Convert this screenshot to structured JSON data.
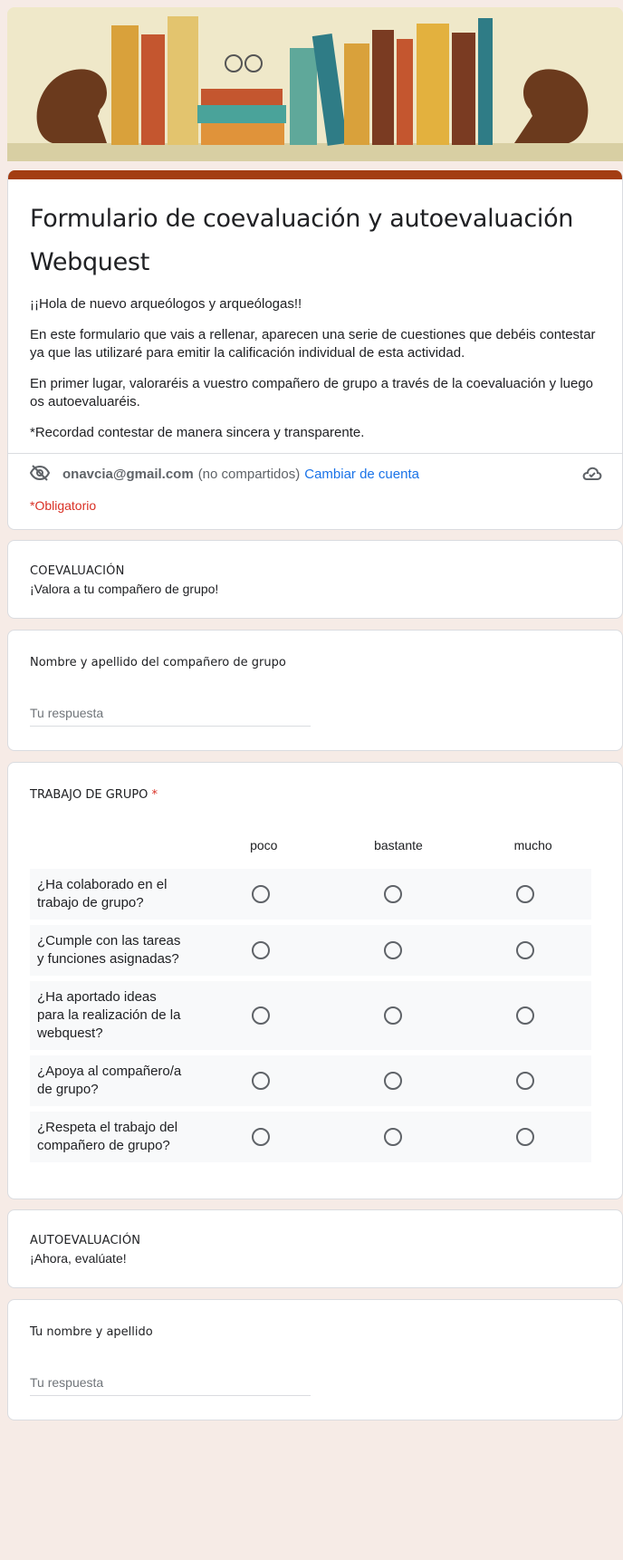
{
  "form": {
    "title": "Formulario de coevaluación y autoevaluación Webquest",
    "description": [
      "¡¡Hola de nuevo arqueólogos y arqueólogas!!",
      "En este formulario que vais a rellenar, aparecen una serie de cuestiones que debéis contestar ya que las utilizaré para emitir la calificación individual de esta actividad.",
      "En primer lugar, valoraréis a vuestro compañero de grupo a través de la coevaluación y luego os autoevaluaréis.",
      "*Recordad contestar de manera sincera y transparente."
    ],
    "account_email": "onavcia@gmail.com",
    "account_note": "(no compartidos)",
    "switch_account": "Cambiar de cuenta",
    "required_note": "*Obligatorio"
  },
  "sections": {
    "coevaluacion": {
      "title": "COEVALUACIÓN",
      "subtitle": "¡Valora a tu compañero de grupo!"
    },
    "autoevaluacion": {
      "title": "AUTOEVALUACIÓN",
      "subtitle": "¡Ahora, evalúate!"
    }
  },
  "questions": {
    "partner_name": {
      "title": "Nombre y apellido del compañero de grupo",
      "placeholder": "Tu respuesta"
    },
    "group_work": {
      "title": "TRABAJO DE GRUPO",
      "required_mark": "*",
      "columns": [
        "poco",
        "bastante",
        "mucho"
      ],
      "rows": [
        "¿Ha colaborado en el trabajo de grupo?",
        "¿Cumple con las tareas y funciones asignadas?",
        "¿Ha aportado ideas para la realización de la webquest?",
        "¿Apoya al compañero/a de grupo?",
        "¿Respeta el trabajo del compañero de grupo?"
      ]
    },
    "own_name": {
      "title": "Tu nombre y apellido",
      "placeholder": "Tu respuesta"
    }
  },
  "colors": {
    "header_bar": "#a33d12",
    "background": "#f6ebe6",
    "link": "#1a73e8",
    "required": "#d93025"
  },
  "icons": {
    "visibility": "eye-off-icon",
    "cloud": "cloud-saved-icon"
  }
}
